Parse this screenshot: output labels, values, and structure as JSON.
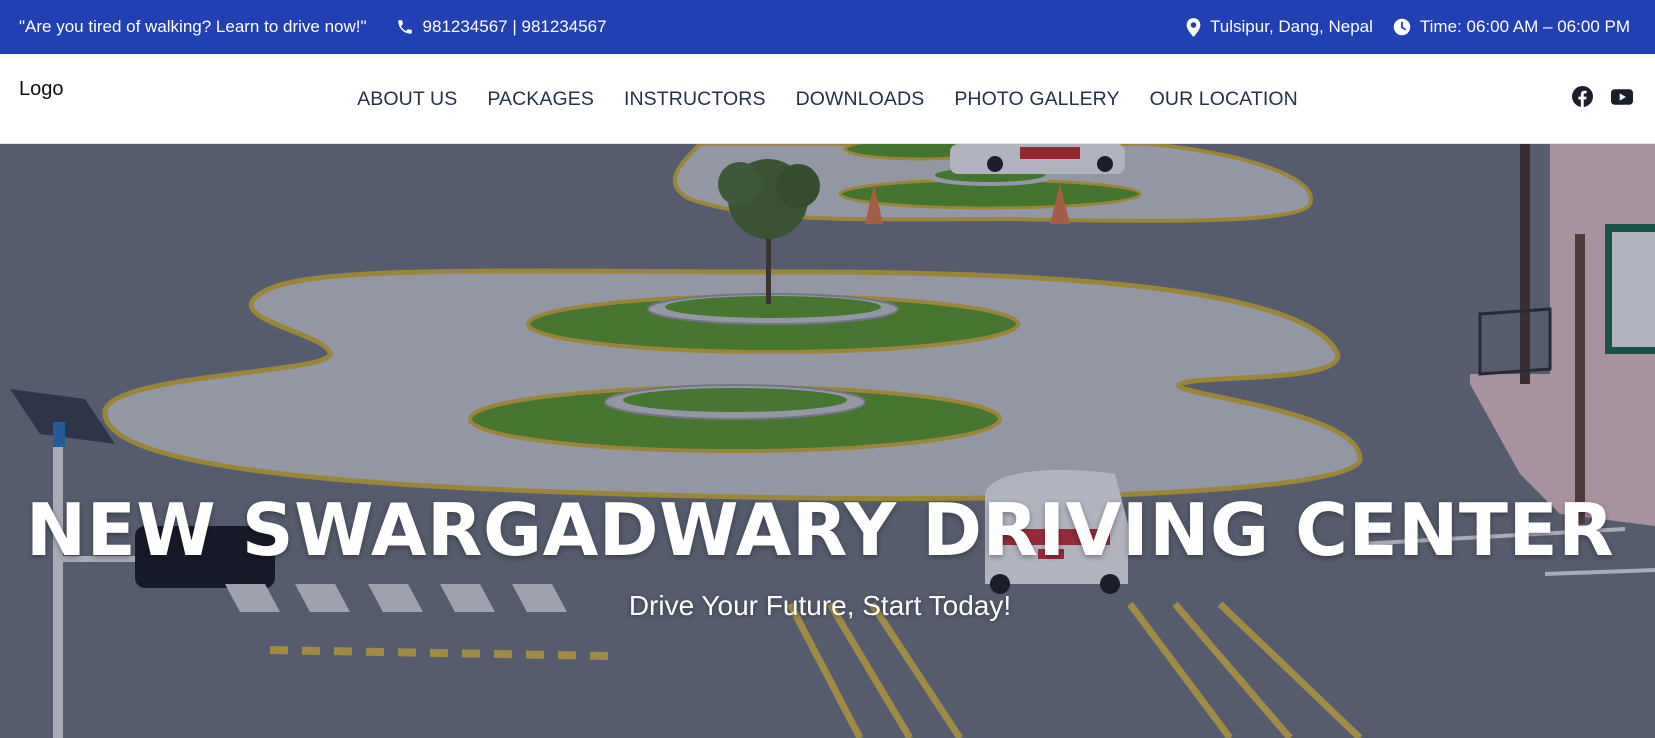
{
  "topbar": {
    "tagline": "\"Are you tired of walking? Learn to drive now!\"",
    "phone": "981234567 | 981234567",
    "location": "Tulsipur, Dang, Nepal",
    "hours": "Time: 06:00 AM – 06:00 PM",
    "icons": [
      "phone-icon",
      "map-pin-icon",
      "clock-icon"
    ],
    "background": "#2040b4"
  },
  "navbar": {
    "logo": "Logo",
    "links": [
      {
        "label": "ABOUT US"
      },
      {
        "label": "PACKAGES"
      },
      {
        "label": "INSTRUCTORS"
      },
      {
        "label": "DOWNLOADS"
      },
      {
        "label": "PHOTO GALLERY"
      },
      {
        "label": "OUR LOCATION"
      }
    ],
    "social": [
      "facebook-icon",
      "youtube-icon"
    ]
  },
  "hero": {
    "title": "NEW SWARGADWARY DRIVING CENTER",
    "subtitle": "Drive Your Future, Start Today!"
  }
}
